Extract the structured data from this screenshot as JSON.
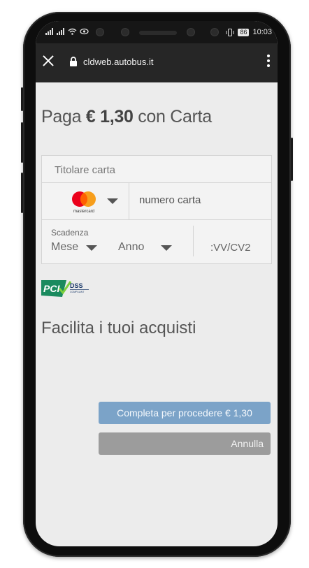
{
  "statusbar": {
    "battery": "86",
    "time": "10:03",
    "icons": [
      "signal-icon",
      "signal-icon",
      "wifi-icon",
      "eye-icon",
      "vibrate-icon",
      "battery-icon"
    ]
  },
  "browser": {
    "url": "cldweb.autobus.it",
    "close_icon": "close-icon",
    "lock_icon": "lock-icon",
    "menu_icon": "kebab-menu-icon"
  },
  "payment": {
    "title_prefix": "Paga",
    "amount": "€ 1,30",
    "title_suffix": "con Carta"
  },
  "card_form": {
    "holder_placeholder": "Titolare carta",
    "brand": "mastercard",
    "number_placeholder": "numero carta",
    "expiry_label": "Scadenza",
    "month_placeholder": "Mese",
    "year_placeholder": "Anno",
    "cvv_placeholder": "CVV/CV2",
    "cvv_visible": ":VV/CV2"
  },
  "pci": {
    "logo": "PCI",
    "dss": "DSS",
    "compliant": "COMPLIANT"
  },
  "section": {
    "facilita": "Facilita i tuoi acquisti"
  },
  "actions": {
    "complete_label": "Completa per procedere € 1,30",
    "cancel_label": "Annulla"
  },
  "colors": {
    "primary_button": "#7ba3c8",
    "cancel_button": "#9c9c9c",
    "urlbar": "#262626",
    "page_bg": "#ececec",
    "mastercard_red": "#eb001b",
    "mastercard_orange": "#f79e1b",
    "pci_green": "#1a8a5e",
    "pci_navy": "#1d3b6b"
  }
}
